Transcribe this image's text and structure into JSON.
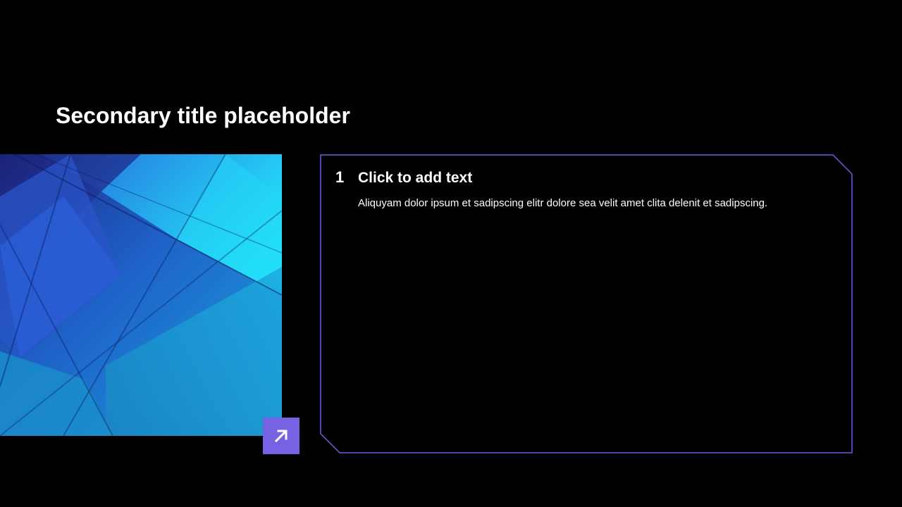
{
  "slide": {
    "title": "Secondary title placeholder"
  },
  "content": {
    "number": "1",
    "heading": "Click to add text",
    "body": "Aliquyam dolor ipsum et sadipscing elitr dolore sea velit amet clita delenit et sadipscing."
  },
  "icons": {
    "arrow_button_icon": "arrow-up-right-icon"
  },
  "colors": {
    "background": "#000000",
    "accent": "#7563e3",
    "frame_border": "#6b5ce0",
    "text": "#ffffff"
  }
}
